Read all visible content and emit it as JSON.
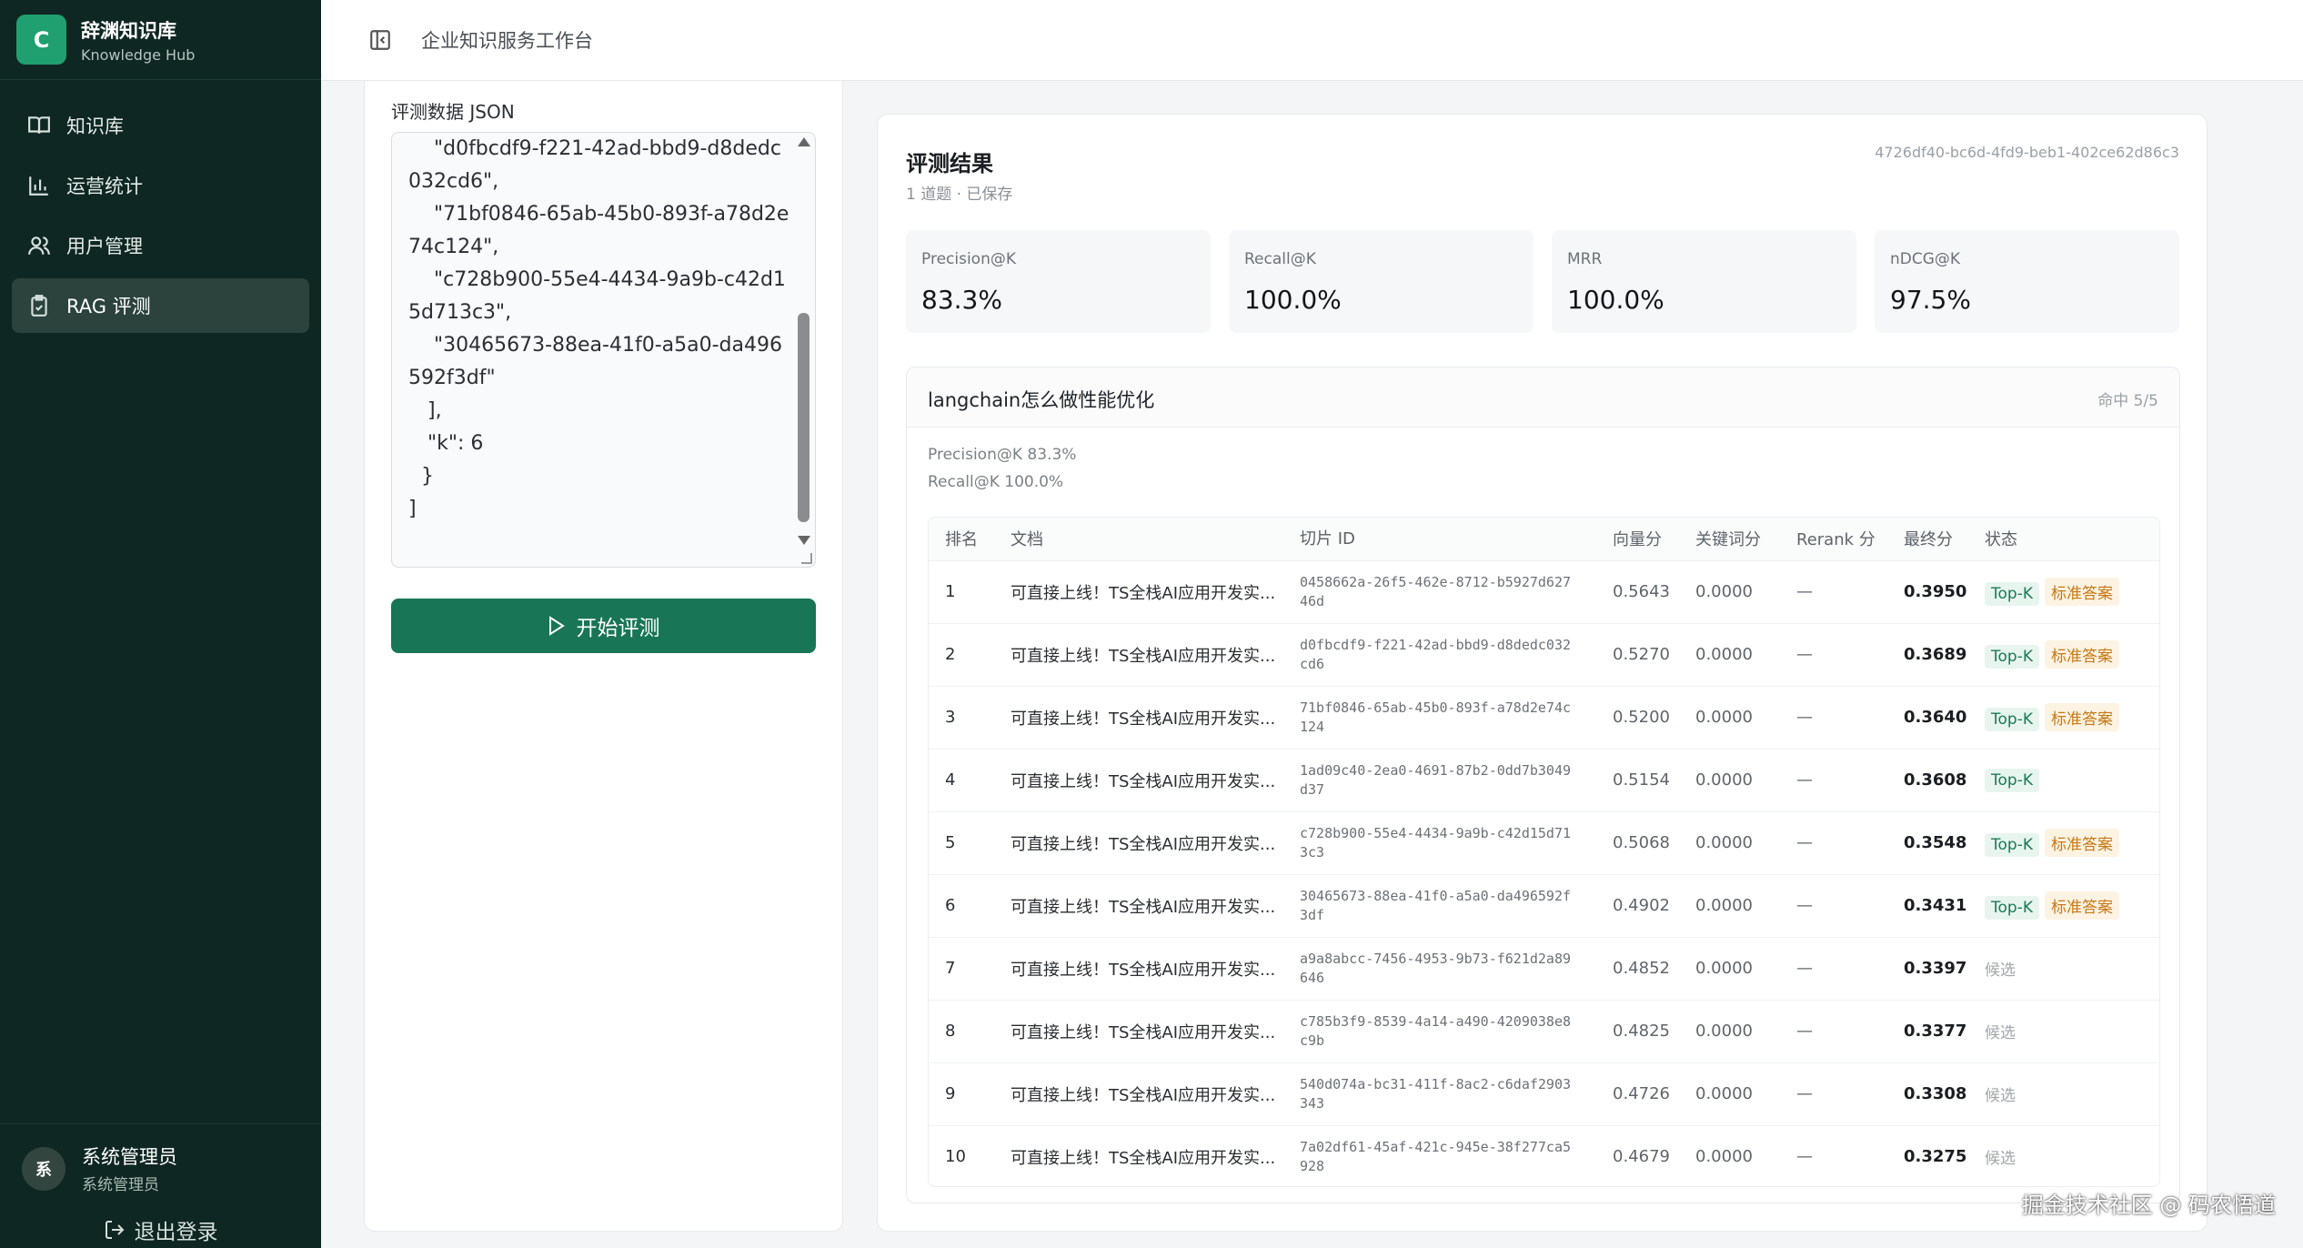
{
  "brand": {
    "logo_letter": "C",
    "title": "辞渊知识库",
    "subtitle": "Knowledge Hub"
  },
  "nav": [
    {
      "label": "知识库",
      "icon": "book-icon",
      "active": false
    },
    {
      "label": "运营统计",
      "icon": "bar-chart-icon",
      "active": false
    },
    {
      "label": "用户管理",
      "icon": "users-icon",
      "active": false
    },
    {
      "label": "RAG 评测",
      "icon": "clipboard-check-icon",
      "active": true
    }
  ],
  "user": {
    "avatar": "系",
    "name": "系统管理员",
    "role": "系统管理员",
    "logout": "退出登录"
  },
  "header": {
    "title": "企业知识服务工作台"
  },
  "input_panel": {
    "label": "评测数据 JSON",
    "json_text": "    \"d0fbcdf9-f221-42ad-bbd9-d8dedc032cd6\",\n    \"71bf0846-65ab-45b0-893f-a78d2e74c124\",\n    \"c728b900-55e4-4434-9a9b-c42d15d713c3\",\n    \"30465673-88ea-41f0-a5a0-da496592f3df\"\n   ],\n   \"k\": 6\n  }\n]",
    "run_button": "开始评测"
  },
  "results": {
    "title": "评测结果",
    "subtitle": "1 道题 · 已保存",
    "run_id": "4726df40-bc6d-4fd9-beb1-402ce62d86c3",
    "metrics": [
      {
        "label": "Precision@K",
        "value": "83.3%"
      },
      {
        "label": "Recall@K",
        "value": "100.0%"
      },
      {
        "label": "MRR",
        "value": "100.0%"
      },
      {
        "label": "nDCG@K",
        "value": "97.5%"
      }
    ],
    "query": {
      "text": "langchain怎么做性能优化",
      "hit": "命中 5/5",
      "precision": "Precision@K 83.3%",
      "recall": "Recall@K 100.0%"
    },
    "table": {
      "headers": [
        "排名",
        "文档",
        "切片 ID",
        "向量分",
        "关键词分",
        "Rerank 分",
        "最终分",
        "状态"
      ],
      "rows": [
        {
          "rank": "1",
          "doc": "可直接上线！TS全栈AI应用开发实...",
          "chunk": "0458662a-26f5-462e-8712-b5927d62746d",
          "vec": "0.5643",
          "kw": "0.0000",
          "rerank": "—",
          "final": "0.3950",
          "topk": "Top-K",
          "std": "标准答案",
          "cand": ""
        },
        {
          "rank": "2",
          "doc": "可直接上线！TS全栈AI应用开发实...",
          "chunk": "d0fbcdf9-f221-42ad-bbd9-d8dedc032cd6",
          "vec": "0.5270",
          "kw": "0.0000",
          "rerank": "—",
          "final": "0.3689",
          "topk": "Top-K",
          "std": "标准答案",
          "cand": ""
        },
        {
          "rank": "3",
          "doc": "可直接上线！TS全栈AI应用开发实...",
          "chunk": "71bf0846-65ab-45b0-893f-a78d2e74c124",
          "vec": "0.5200",
          "kw": "0.0000",
          "rerank": "—",
          "final": "0.3640",
          "topk": "Top-K",
          "std": "标准答案",
          "cand": ""
        },
        {
          "rank": "4",
          "doc": "可直接上线！TS全栈AI应用开发实...",
          "chunk": "1ad09c40-2ea0-4691-87b2-0dd7b3049d37",
          "vec": "0.5154",
          "kw": "0.0000",
          "rerank": "—",
          "final": "0.3608",
          "topk": "Top-K",
          "std": "",
          "cand": ""
        },
        {
          "rank": "5",
          "doc": "可直接上线！TS全栈AI应用开发实...",
          "chunk": "c728b900-55e4-4434-9a9b-c42d15d713c3",
          "vec": "0.5068",
          "kw": "0.0000",
          "rerank": "—",
          "final": "0.3548",
          "topk": "Top-K",
          "std": "标准答案",
          "cand": ""
        },
        {
          "rank": "6",
          "doc": "可直接上线！TS全栈AI应用开发实...",
          "chunk": "30465673-88ea-41f0-a5a0-da496592f3df",
          "vec": "0.4902",
          "kw": "0.0000",
          "rerank": "—",
          "final": "0.3431",
          "topk": "Top-K",
          "std": "标准答案",
          "cand": ""
        },
        {
          "rank": "7",
          "doc": "可直接上线！TS全栈AI应用开发实...",
          "chunk": "a9a8abcc-7456-4953-9b73-f621d2a89646",
          "vec": "0.4852",
          "kw": "0.0000",
          "rerank": "—",
          "final": "0.3397",
          "topk": "",
          "std": "",
          "cand": "候选"
        },
        {
          "rank": "8",
          "doc": "可直接上线！TS全栈AI应用开发实...",
          "chunk": "c785b3f9-8539-4a14-a490-4209038e8c9b",
          "vec": "0.4825",
          "kw": "0.0000",
          "rerank": "—",
          "final": "0.3377",
          "topk": "",
          "std": "",
          "cand": "候选"
        },
        {
          "rank": "9",
          "doc": "可直接上线！TS全栈AI应用开发实...",
          "chunk": "540d074a-bc31-411f-8ac2-c6daf2903343",
          "vec": "0.4726",
          "kw": "0.0000",
          "rerank": "—",
          "final": "0.3308",
          "topk": "",
          "std": "",
          "cand": "候选"
        },
        {
          "rank": "10",
          "doc": "可直接上线！TS全栈AI应用开发实...",
          "chunk": "7a02df61-45af-421c-945e-38f277ca5928",
          "vec": "0.4679",
          "kw": "0.0000",
          "rerank": "—",
          "final": "0.3275",
          "topk": "",
          "std": "",
          "cand": "候选"
        }
      ]
    }
  },
  "watermark": "掘金技术社区 @ 码农悟道",
  "colors": {
    "sidebar_bg": "#0f2722",
    "accent": "#187555",
    "topk": "#1b7a56",
    "standard": "#c77914"
  }
}
